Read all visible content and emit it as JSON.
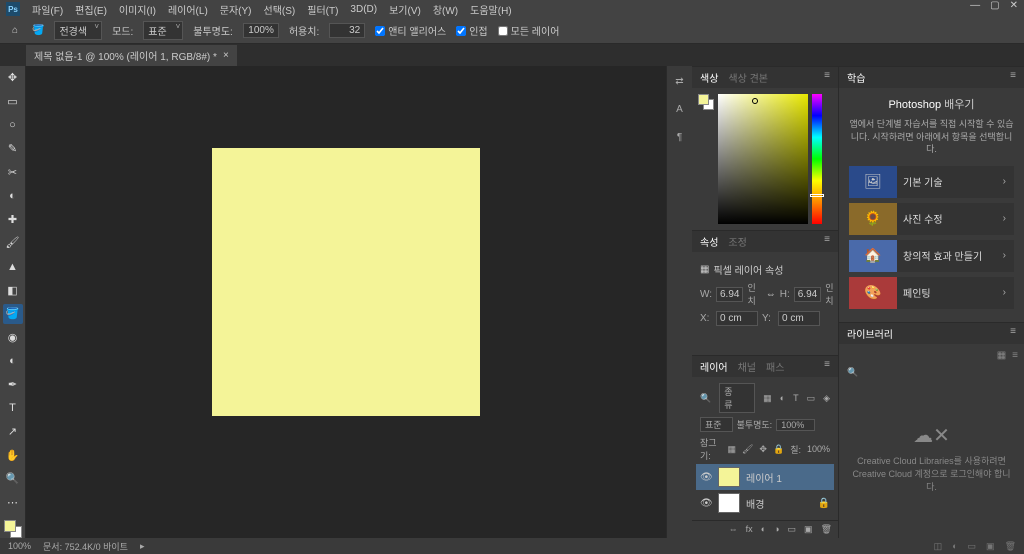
{
  "app": {
    "logo": "Ps"
  },
  "menu": [
    "파일(F)",
    "편집(E)",
    "이미지(I)",
    "레이어(L)",
    "문자(Y)",
    "선택(S)",
    "필터(T)",
    "3D(D)",
    "보기(V)",
    "창(W)",
    "도움말(H)"
  ],
  "options": {
    "swatch_dd": "전경색",
    "mode_lbl": "모드:",
    "mode_val": "표준",
    "opacity_lbl": "불투명도:",
    "opacity_val": "100%",
    "tolerance_lbl": "허용치:",
    "tolerance_val": "32",
    "chk_aa": "앤티 앨리어스",
    "chk_contig": "인접",
    "chk_all": "모든 레이어"
  },
  "doctab": {
    "title": "제목 없음-1 @ 100% (레이어 1, RGB/8#) *"
  },
  "panels": {
    "color_tab": "색상",
    "color_tab2": "색상 견본",
    "props_tab": "속성",
    "props_tab2": "조정",
    "props_title": "픽셀 레이어 속성",
    "props": {
      "w_lbl": "W:",
      "w_val": "6.94",
      "w_unit": "인치",
      "link": "⇔",
      "h_lbl": "H:",
      "h_val": "6.94",
      "h_unit": "인치",
      "x_lbl": "X:",
      "x_val": "0 cm",
      "y_lbl": "Y:",
      "y_val": "0 cm"
    },
    "layers_tab": "레이어",
    "layers_tab2": "채널",
    "layers_tab3": "패스",
    "layers": {
      "kind_lbl": "종류",
      "blend_val": "표준",
      "opacity_lbl": "불투명도:",
      "opacity_val": "100%",
      "lock_lbl": "잠그기:",
      "fill_lbl": "칠:",
      "fill_val": "100%",
      "item1": "레이어 1",
      "item2": "배경"
    }
  },
  "learn": {
    "tab": "학습",
    "title_main": "Photoshop",
    "title_sub": "배우기",
    "sub": "앱에서 단계별 자습서를 직접 시작할 수 있습니다. 시작하려면 아래에서 항목을 선택합니다.",
    "cards": [
      "기본 기술",
      "사진 수정",
      "창의적 효과 만들기",
      "페인팅"
    ]
  },
  "library": {
    "tab": "라이브러리",
    "cc_text": "Creative Cloud Libraries를 사용하려면 Creative Cloud 계정으로 로그인해야 합니다."
  },
  "status": {
    "zoom": "100%",
    "doc": "문서: 752.4K/0 바이트"
  },
  "footer_icons": "x3"
}
